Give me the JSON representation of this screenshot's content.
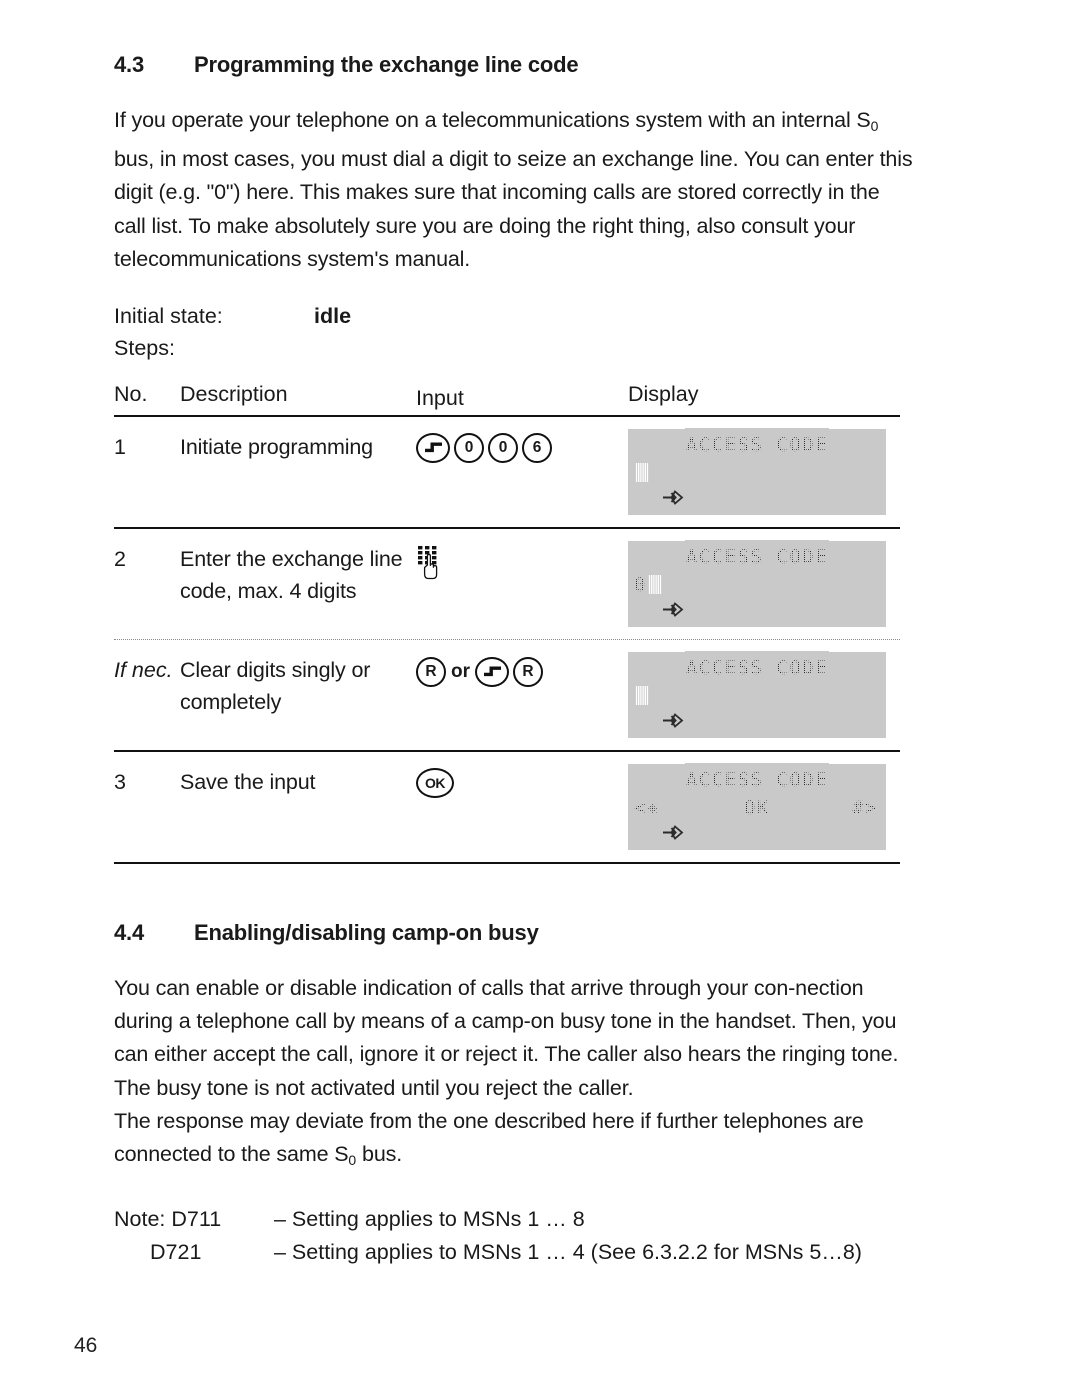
{
  "page": {
    "number": "46"
  },
  "section_4_3": {
    "number": "4.3",
    "title": "Programming the exchange line code",
    "body_part1": "If you operate your telephone on a telecommunications system with an internal S",
    "body_sub": "0",
    "body_part2": " bus, in most cases, you must dial a digit to seize an exchange line. You can enter this digit (e.g. \"0\") here. This makes sure that incoming calls are stored correctly in the call list. To make absolutely sure you are doing the right thing, also consult your telecommunications system's manual.",
    "initial_state_label": "Initial state:",
    "initial_state_value": "idle",
    "steps_label": "Steps:"
  },
  "table": {
    "headers": {
      "no": "No.",
      "description": "Description",
      "input": "Input",
      "display": "Display"
    },
    "rows": [
      {
        "no": "1",
        "description": "Initiate programming",
        "input_keys": [
          {
            "type": "step-key",
            "label": ""
          },
          {
            "type": "digit",
            "label": "0"
          },
          {
            "type": "digit",
            "label": "0"
          },
          {
            "type": "digit",
            "label": "6"
          }
        ],
        "display": {
          "line1": "ACCESS CODE",
          "line2_left": "",
          "line2_cursor": true,
          "line2_mid": "",
          "line2_right": "",
          "line3_arrow": true
        }
      },
      {
        "no": "2",
        "description": "Enter the exchange line code, max. 4 digits",
        "input_keys": [
          {
            "type": "keypad-hand",
            "label": ""
          }
        ],
        "display": {
          "line1": "ACCESS CODE",
          "line2_left": "0",
          "line2_cursor": true,
          "line2_mid": "",
          "line2_right": "",
          "line3_arrow": true
        }
      },
      {
        "no": "If nec.",
        "description": "Clear digits singly or completely",
        "input_keys": [
          {
            "type": "letter",
            "label": "R"
          },
          {
            "type": "word",
            "label": "or"
          },
          {
            "type": "step-key",
            "label": ""
          },
          {
            "type": "letter",
            "label": "R"
          }
        ],
        "display": {
          "line1": "ACCESS CODE",
          "line2_left": "",
          "line2_cursor": true,
          "line2_mid": "",
          "line2_right": "",
          "line3_arrow": true
        }
      },
      {
        "no": "3",
        "description": "Save the input",
        "input_keys": [
          {
            "type": "ok",
            "label": "OK"
          }
        ],
        "display": {
          "line1": "ACCESS CODE",
          "line2_left": "<✳",
          "line2_cursor": false,
          "line2_mid": "OK",
          "line2_right": "#>",
          "line3_arrow": true
        }
      }
    ]
  },
  "section_4_4": {
    "number": "4.4",
    "title": "Enabling/disabling camp-on busy",
    "body1": "You can enable or disable indication of calls that arrive through your con-nection during a telephone call by means of a camp-on busy tone in the handset. Then, you can either accept the call, ignore it or reject it. The caller also hears the ringing tone. The busy tone is not activated until you reject the caller.",
    "body2_part1": "The response may deviate from the one described here if further telephones are connected to the same S",
    "body2_sub": "0",
    "body2_part2": " bus.",
    "notes": [
      {
        "label": "Note: D711",
        "text": "– Setting applies to MSNs 1 … 8"
      },
      {
        "label": "D721",
        "text": "– Setting applies to MSNs 1 … 4 (See 6.3.2.2 for MSNs 5…8)"
      }
    ]
  }
}
